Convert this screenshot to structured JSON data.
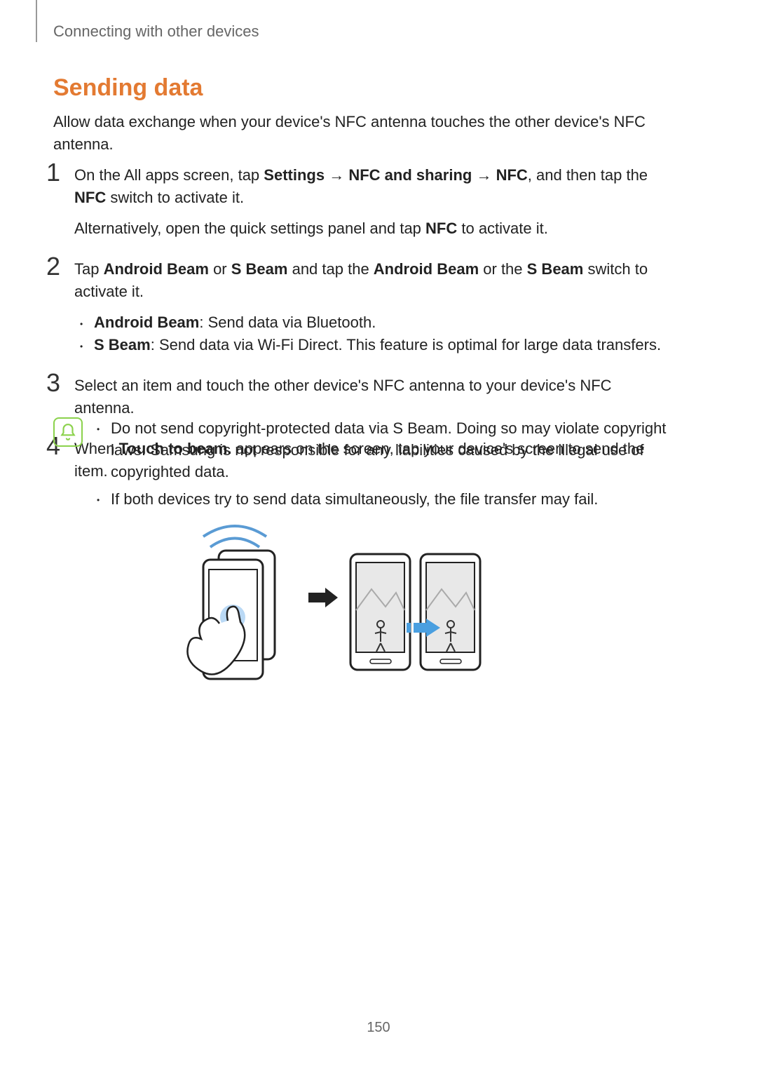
{
  "header": "Connecting with other devices",
  "section_title": "Sending data",
  "intro": "Allow data exchange when your device's NFC antenna touches the other device's NFC antenna.",
  "page_number": "150",
  "steps": {
    "s1": {
      "num": "1",
      "p1_a": "On the All apps screen, tap ",
      "p1_b": "Settings",
      "p1_c": " → ",
      "p1_d": "NFC and sharing",
      "p1_e": " → ",
      "p1_f": "NFC",
      "p1_g": ", and then tap the ",
      "p1_h": "NFC",
      "p1_i": " switch to activate it.",
      "p2_a": "Alternatively, open the quick settings panel and tap ",
      "p2_b": "NFC",
      "p2_c": " to activate it."
    },
    "s2": {
      "num": "2",
      "p1_a": "Tap ",
      "p1_b": "Android Beam",
      "p1_c": " or ",
      "p1_d": "S Beam",
      "p1_e": " and tap the ",
      "p1_f": "Android Beam",
      "p1_g": " or the ",
      "p1_h": "S Beam",
      "p1_i": " switch to activate it.",
      "sub1_a": "Android Beam",
      "sub1_b": ": Send data via Bluetooth.",
      "sub2_a": "S Beam",
      "sub2_b": ": Send data via Wi-Fi Direct. This feature is optimal for large data transfers."
    },
    "s3": {
      "num": "3",
      "p1": "Select an item and touch the other device's NFC antenna to your device's NFC antenna."
    },
    "s4": {
      "num": "4",
      "p1_a": "When ",
      "p1_b": "Touch to beam.",
      "p1_c": " appears on the screen, tap your device's screen to send the item."
    }
  },
  "notes": {
    "n1": "Do not send copyright-protected data via S Beam. Doing so may violate copyright laws. Samsung is not responsible for any liabilities caused by the illegal use of copyrighted data.",
    "n2": "If both devices try to send data simultaneously, the file transfer may fail."
  }
}
